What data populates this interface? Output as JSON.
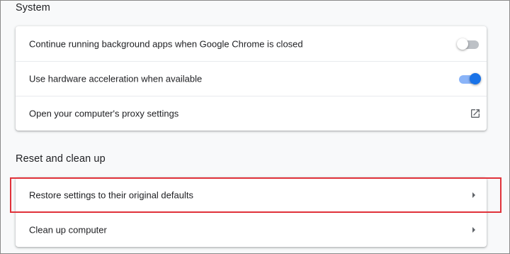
{
  "system": {
    "title": "System",
    "rows": [
      {
        "label": "Continue running background apps when Google Chrome is closed",
        "control": "toggle",
        "on": false
      },
      {
        "label": "Use hardware acceleration when available",
        "control": "toggle",
        "on": true
      },
      {
        "label": "Open your computer's proxy settings",
        "control": "open-in-new-icon"
      }
    ]
  },
  "reset": {
    "title": "Reset and clean up",
    "rows": [
      {
        "label": "Restore settings to their original defaults",
        "control": "chevron-right-icon"
      },
      {
        "label": "Clean up computer",
        "control": "chevron-right-icon"
      }
    ]
  },
  "colors": {
    "accent": "#1a73e8",
    "accent_track": "#8ab4f8",
    "highlight": "#e0323a"
  }
}
